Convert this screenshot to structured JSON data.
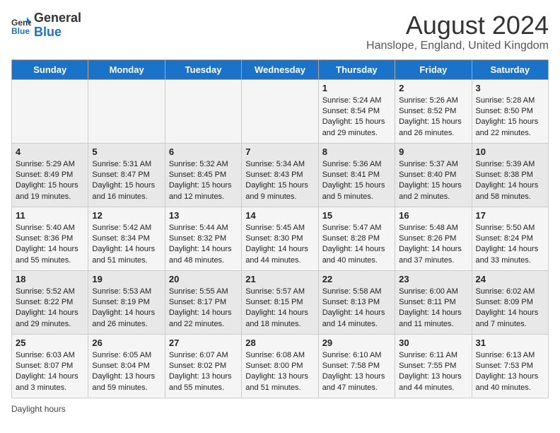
{
  "header": {
    "logo_general": "General",
    "logo_blue": "Blue",
    "main_title": "August 2024",
    "subtitle": "Hanslope, England, United Kingdom"
  },
  "days_of_week": [
    "Sunday",
    "Monday",
    "Tuesday",
    "Wednesday",
    "Thursday",
    "Friday",
    "Saturday"
  ],
  "footer": {
    "note": "Daylight hours"
  },
  "weeks": [
    [
      {
        "day": "",
        "info": ""
      },
      {
        "day": "",
        "info": ""
      },
      {
        "day": "",
        "info": ""
      },
      {
        "day": "",
        "info": ""
      },
      {
        "day": "1",
        "info": "Sunrise: 5:24 AM\nSunset: 8:54 PM\nDaylight: 15 hours and 29 minutes."
      },
      {
        "day": "2",
        "info": "Sunrise: 5:26 AM\nSunset: 8:52 PM\nDaylight: 15 hours and 26 minutes."
      },
      {
        "day": "3",
        "info": "Sunrise: 5:28 AM\nSunset: 8:50 PM\nDaylight: 15 hours and 22 minutes."
      }
    ],
    [
      {
        "day": "4",
        "info": "Sunrise: 5:29 AM\nSunset: 8:49 PM\nDaylight: 15 hours and 19 minutes."
      },
      {
        "day": "5",
        "info": "Sunrise: 5:31 AM\nSunset: 8:47 PM\nDaylight: 15 hours and 16 minutes."
      },
      {
        "day": "6",
        "info": "Sunrise: 5:32 AM\nSunset: 8:45 PM\nDaylight: 15 hours and 12 minutes."
      },
      {
        "day": "7",
        "info": "Sunrise: 5:34 AM\nSunset: 8:43 PM\nDaylight: 15 hours and 9 minutes."
      },
      {
        "day": "8",
        "info": "Sunrise: 5:36 AM\nSunset: 8:41 PM\nDaylight: 15 hours and 5 minutes."
      },
      {
        "day": "9",
        "info": "Sunrise: 5:37 AM\nSunset: 8:40 PM\nDaylight: 15 hours and 2 minutes."
      },
      {
        "day": "10",
        "info": "Sunrise: 5:39 AM\nSunset: 8:38 PM\nDaylight: 14 hours and 58 minutes."
      }
    ],
    [
      {
        "day": "11",
        "info": "Sunrise: 5:40 AM\nSunset: 8:36 PM\nDaylight: 14 hours and 55 minutes."
      },
      {
        "day": "12",
        "info": "Sunrise: 5:42 AM\nSunset: 8:34 PM\nDaylight: 14 hours and 51 minutes."
      },
      {
        "day": "13",
        "info": "Sunrise: 5:44 AM\nSunset: 8:32 PM\nDaylight: 14 hours and 48 minutes."
      },
      {
        "day": "14",
        "info": "Sunrise: 5:45 AM\nSunset: 8:30 PM\nDaylight: 14 hours and 44 minutes."
      },
      {
        "day": "15",
        "info": "Sunrise: 5:47 AM\nSunset: 8:28 PM\nDaylight: 14 hours and 40 minutes."
      },
      {
        "day": "16",
        "info": "Sunrise: 5:48 AM\nSunset: 8:26 PM\nDaylight: 14 hours and 37 minutes."
      },
      {
        "day": "17",
        "info": "Sunrise: 5:50 AM\nSunset: 8:24 PM\nDaylight: 14 hours and 33 minutes."
      }
    ],
    [
      {
        "day": "18",
        "info": "Sunrise: 5:52 AM\nSunset: 8:22 PM\nDaylight: 14 hours and 29 minutes."
      },
      {
        "day": "19",
        "info": "Sunrise: 5:53 AM\nSunset: 8:19 PM\nDaylight: 14 hours and 26 minutes."
      },
      {
        "day": "20",
        "info": "Sunrise: 5:55 AM\nSunset: 8:17 PM\nDaylight: 14 hours and 22 minutes."
      },
      {
        "day": "21",
        "info": "Sunrise: 5:57 AM\nSunset: 8:15 PM\nDaylight: 14 hours and 18 minutes."
      },
      {
        "day": "22",
        "info": "Sunrise: 5:58 AM\nSunset: 8:13 PM\nDaylight: 14 hours and 14 minutes."
      },
      {
        "day": "23",
        "info": "Sunrise: 6:00 AM\nSunset: 8:11 PM\nDaylight: 14 hours and 11 minutes."
      },
      {
        "day": "24",
        "info": "Sunrise: 6:02 AM\nSunset: 8:09 PM\nDaylight: 14 hours and 7 minutes."
      }
    ],
    [
      {
        "day": "25",
        "info": "Sunrise: 6:03 AM\nSunset: 8:07 PM\nDaylight: 14 hours and 3 minutes."
      },
      {
        "day": "26",
        "info": "Sunrise: 6:05 AM\nSunset: 8:04 PM\nDaylight: 13 hours and 59 minutes."
      },
      {
        "day": "27",
        "info": "Sunrise: 6:07 AM\nSunset: 8:02 PM\nDaylight: 13 hours and 55 minutes."
      },
      {
        "day": "28",
        "info": "Sunrise: 6:08 AM\nSunset: 8:00 PM\nDaylight: 13 hours and 51 minutes."
      },
      {
        "day": "29",
        "info": "Sunrise: 6:10 AM\nSunset: 7:58 PM\nDaylight: 13 hours and 47 minutes."
      },
      {
        "day": "30",
        "info": "Sunrise: 6:11 AM\nSunset: 7:55 PM\nDaylight: 13 hours and 44 minutes."
      },
      {
        "day": "31",
        "info": "Sunrise: 6:13 AM\nSunset: 7:53 PM\nDaylight: 13 hours and 40 minutes."
      }
    ]
  ]
}
